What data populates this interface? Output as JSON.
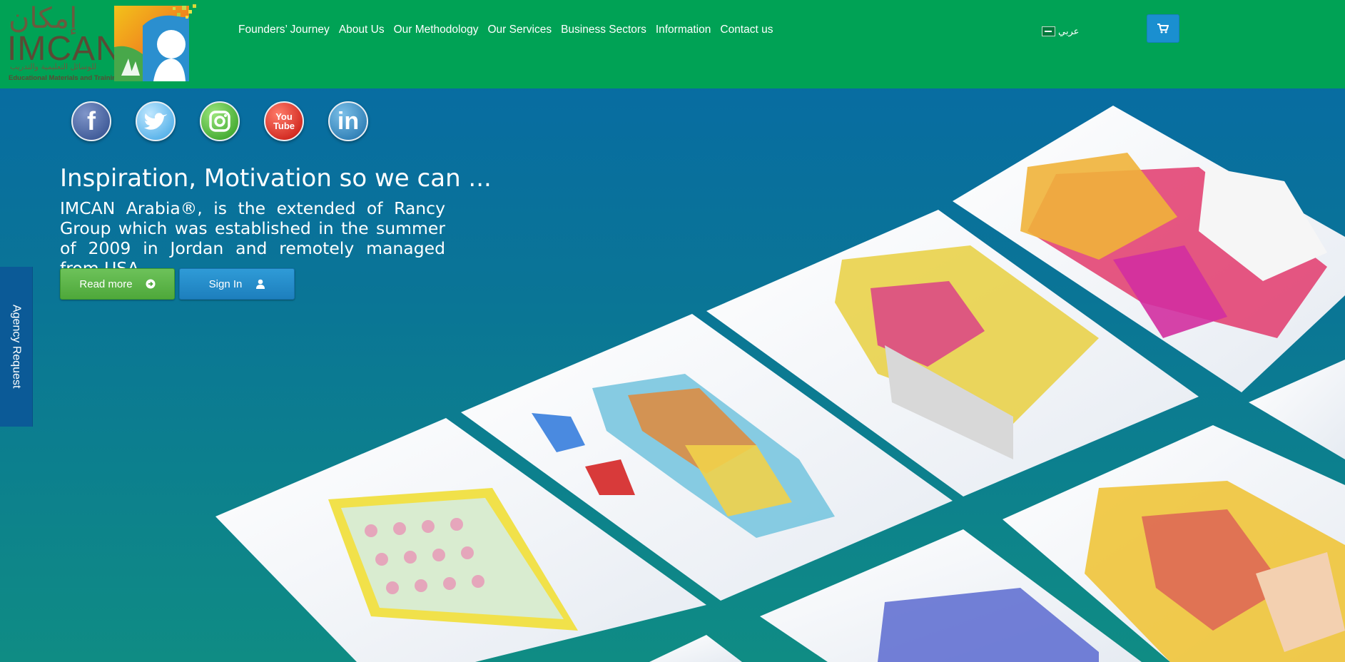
{
  "header": {
    "logo": {
      "arabic_name": "إمكان",
      "english_name": "IMCAN",
      "arabic_tagline": "للوسائل التعليمية والتدريب",
      "english_tagline": "Educational Materials and Training"
    },
    "nav": [
      {
        "label": "Founders’ Journey"
      },
      {
        "label": "About Us"
      },
      {
        "label": "Our Methodology"
      },
      {
        "label": "Our Services"
      },
      {
        "label": "Business Sectors"
      },
      {
        "label": "Information"
      },
      {
        "label": "Contact us"
      }
    ],
    "language_label": "عربي",
    "cart_icon": "shopping-cart-icon"
  },
  "social": [
    {
      "name": "facebook-icon",
      "glyph": "f"
    },
    {
      "name": "twitter-icon",
      "glyph": ""
    },
    {
      "name": "instagram-icon",
      "glyph": ""
    },
    {
      "name": "youtube-icon",
      "glyph": "You Tube"
    },
    {
      "name": "linkedin-icon",
      "glyph": "in"
    }
  ],
  "hero": {
    "title": "Inspiration, Motivation so we can ...",
    "text": "IMCAN Arabia®, is the extended of Rancy Group which was established in the summer of 2009 in Jordan and remotely managed from USA.",
    "read_more_label": "Read more",
    "sign_in_label": "Sign In"
  },
  "side_tab": {
    "label": "Agency Request"
  },
  "colors": {
    "header_green": "#00a255",
    "hero_blue": "#0769a6",
    "hero_teal": "#0f8c84",
    "read_more_green": "#5cb44a",
    "sign_in_blue": "#2289c9",
    "agency_blue": "#0b5a97"
  }
}
